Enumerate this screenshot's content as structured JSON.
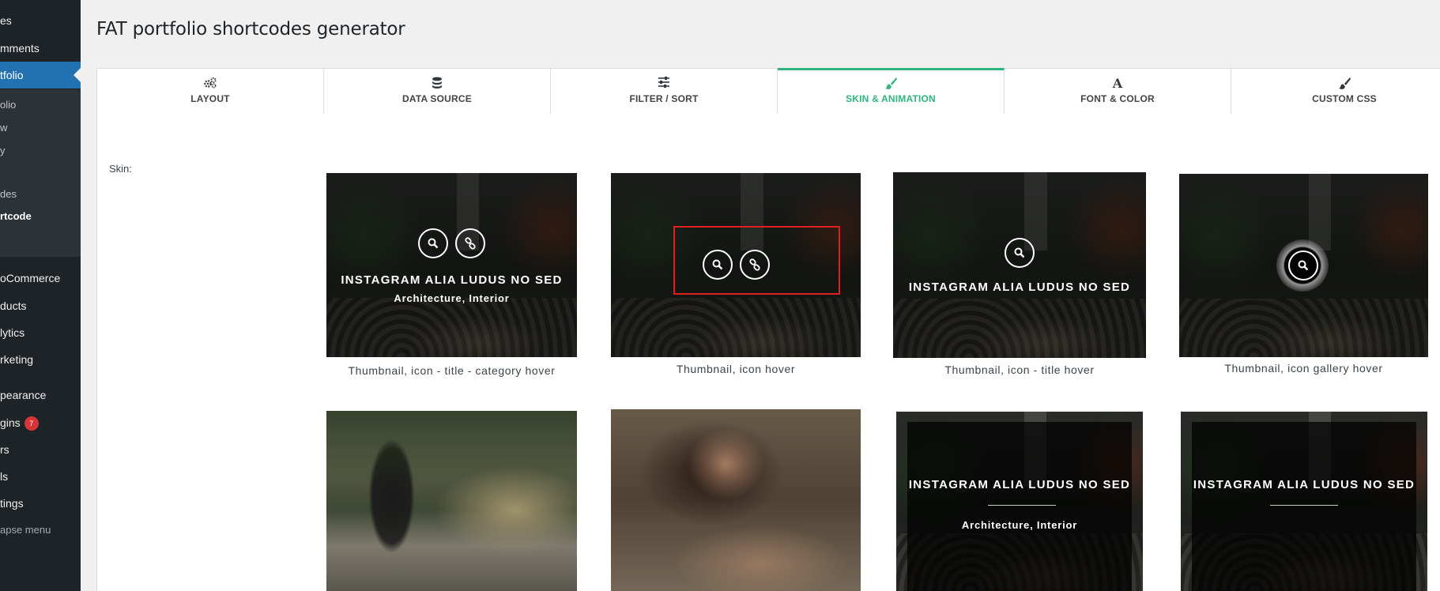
{
  "sidebar": {
    "items": [
      {
        "label": "es"
      },
      {
        "label": "mments"
      },
      {
        "label": "tfolio"
      },
      {
        "label": "oCommerce"
      },
      {
        "label": "ducts"
      },
      {
        "label": "lytics"
      },
      {
        "label": "rketing"
      },
      {
        "label": "pearance"
      },
      {
        "label": "gins"
      },
      {
        "label": "rs"
      },
      {
        "label": "ls"
      },
      {
        "label": "tings"
      },
      {
        "label": "apse menu"
      }
    ],
    "sub_items": [
      {
        "label": "olio"
      },
      {
        "label": "w"
      },
      {
        "label": "y"
      },
      {
        "label": "des"
      },
      {
        "label": "rtcode"
      }
    ],
    "plugins_badge": "7"
  },
  "page_title": "FAT portfolio shortcodes generator",
  "tabs": [
    {
      "label": "LAYOUT",
      "icon": "gears-icon"
    },
    {
      "label": "DATA SOURCE",
      "icon": "database-icon"
    },
    {
      "label": "FILTER / SORT",
      "icon": "sliders-icon"
    },
    {
      "label": "SKIN & ANIMATION",
      "icon": "brush-icon"
    },
    {
      "label": "FONT & COLOR",
      "icon": "font-icon"
    },
    {
      "label": "CUSTOM CSS",
      "icon": "paintbrush-icon"
    }
  ],
  "skin_label": "Skin:",
  "skins": [
    {
      "caption": "Thumbnail, icon - title - category hover",
      "title": "INSTAGRAM ALIA LUDUS NO SED",
      "category": "Architecture, Interior"
    },
    {
      "caption": "Thumbnail, icon hover"
    },
    {
      "caption": "Thumbnail, icon - title hover",
      "title": "INSTAGRAM ALIA LUDUS NO SED"
    },
    {
      "caption": "Thumbnail, icon gallery hover"
    },
    {
      "caption": ""
    },
    {
      "caption": ""
    },
    {
      "caption": "",
      "title": "INSTAGRAM ALIA LUDUS NO SED",
      "category": "Architecture, Interior"
    },
    {
      "caption": "",
      "title": "INSTAGRAM ALIA LUDUS NO SED"
    }
  ],
  "colors": {
    "accent": "#2eb67d",
    "wp_blue": "#2271b1",
    "sidebar_bg": "#1d2327",
    "highlight": "#e02020",
    "badge": "#d63638"
  }
}
